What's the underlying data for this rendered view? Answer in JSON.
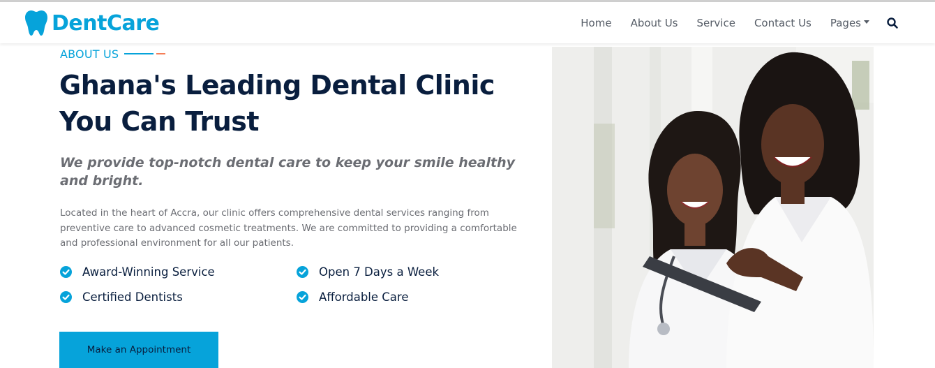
{
  "brand": {
    "name": "DentCare",
    "color": "#06a3da",
    "icon": "tooth-icon"
  },
  "nav": {
    "items": [
      {
        "label": "Home"
      },
      {
        "label": "About Us"
      },
      {
        "label": "Service"
      },
      {
        "label": "Contact Us"
      },
      {
        "label": "Pages"
      }
    ],
    "search_icon": "search-icon"
  },
  "about": {
    "eyebrow": "ABOUT US",
    "headline_line1": "Ghana's Leading Dental Clinic",
    "headline_line2": "You Can Trust",
    "subhead": "We provide top-notch dental care to keep your smile healthy and bright.",
    "paragraph": "Located in the heart of Accra, our clinic offers comprehensive dental services ranging from preventive care to advanced cosmetic treatments. We are committed to providing a comfortable and professional environment for all our patients.",
    "features": [
      {
        "label": "Award-Winning Service"
      },
      {
        "label": "Open 7 Days a Week"
      },
      {
        "label": "Certified Dentists"
      },
      {
        "label": "Affordable Care"
      }
    ],
    "cta_label": "Make an Appointment"
  },
  "colors": {
    "primary": "#06a3da",
    "dark": "#091e3e",
    "accent": "#f57e57",
    "muted": "#6b6d73"
  }
}
